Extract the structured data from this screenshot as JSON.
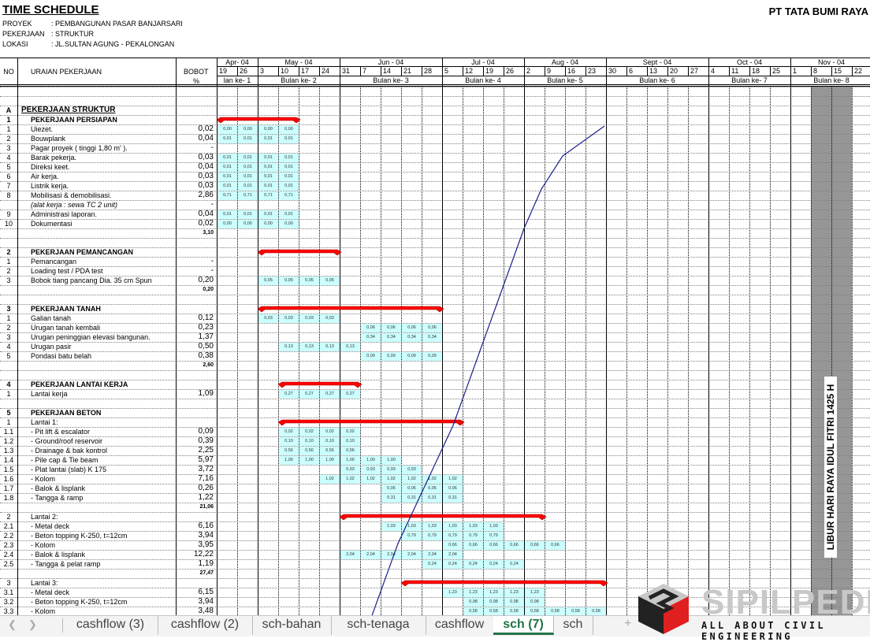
{
  "header": {
    "title": "TIME SCHEDULE",
    "company": "PT TATA BUMI RAYA",
    "meta": [
      {
        "key": "PROYEK",
        "value": ": PEMBANGUNAN PASAR BANJARSARI"
      },
      {
        "key": "PEKERJAAN",
        "value": ": STRUKTUR"
      },
      {
        "key": "LOKASI",
        "value": ": JL.SULTAN AGUNG - PEKALONGAN"
      }
    ]
  },
  "columns": {
    "no": "NO",
    "desc": "URAIAN PEKERJAAN",
    "bobot": "BOBOT",
    "pct": "%",
    "months": [
      {
        "label": "Apr- 04",
        "start": 0,
        "span": 2
      },
      {
        "label": "May - 04",
        "start": 2,
        "span": 4
      },
      {
        "label": "Jun - 04",
        "start": 6,
        "span": 5
      },
      {
        "label": "Jul - 04",
        "start": 11,
        "span": 4
      },
      {
        "label": "Aug - 04",
        "start": 15,
        "span": 4
      },
      {
        "label": "Sept - 04",
        "start": 19,
        "span": 5
      },
      {
        "label": "Oct - 04",
        "start": 24,
        "span": 4
      },
      {
        "label": "Nov - 04",
        "start": 28,
        "span": 4
      }
    ],
    "weeks": [
      "19",
      "26",
      "3",
      "10",
      "17",
      "24",
      "31",
      "7",
      "14",
      "21",
      "28",
      "5",
      "12",
      "19",
      "26",
      "2",
      "9",
      "16",
      "23",
      "30",
      "6",
      "13",
      "20",
      "27",
      "4",
      "11",
      "18",
      "25",
      "1",
      "8",
      "15",
      "22"
    ],
    "bulan": [
      {
        "label": "lan ke- 1",
        "start": 0,
        "span": 2
      },
      {
        "label": "Bulan ke- 2",
        "start": 2,
        "span": 4
      },
      {
        "label": "Bulan ke- 3",
        "start": 6,
        "span": 5
      },
      {
        "label": "Bulan ke- 4",
        "start": 11,
        "span": 4
      },
      {
        "label": "Bulan ke- 5",
        "start": 15,
        "span": 4
      },
      {
        "label": "Bulan ke- 6",
        "start": 19,
        "span": 5
      },
      {
        "label": "Bulan ke- 7",
        "start": 24,
        "span": 4
      },
      {
        "label": "Bulan ke- 8",
        "start": 28,
        "span": 4
      }
    ]
  },
  "rows": [
    {
      "type": "blank"
    },
    {
      "type": "blank"
    },
    {
      "type": "top",
      "no": "A",
      "desc": "PEKERJAAN STRUKTUR"
    },
    {
      "type": "section",
      "no": "1",
      "desc": "PEKERJAAN  PERSIAPAN",
      "bar": [
        0,
        4
      ]
    },
    {
      "no": "1",
      "desc": "Uiezet.",
      "bobot": "0,02",
      "start": 0,
      "cells": [
        "0,00",
        "0,00",
        "0,00",
        "0,00"
      ]
    },
    {
      "no": "2",
      "desc": "Bouwplank",
      "bobot": "0,04",
      "start": 0,
      "cells": [
        "0,01",
        "0,01",
        "0,01",
        "0,01"
      ]
    },
    {
      "no": "3",
      "desc": "Pagar proyek ( tinggi  1,80 m' ).",
      "bobot": "-"
    },
    {
      "no": "4",
      "desc": "Barak pekerja.",
      "bobot": "0,03",
      "start": 0,
      "cells": [
        "0,01",
        "0,01",
        "0,01",
        "0,01"
      ]
    },
    {
      "no": "5",
      "desc": "Direksi keet.",
      "bobot": "0,04",
      "start": 0,
      "cells": [
        "0,01",
        "0,01",
        "0,01",
        "0,01"
      ]
    },
    {
      "no": "6",
      "desc": "Air kerja.",
      "bobot": "0,03",
      "start": 0,
      "cells": [
        "0,01",
        "0,01",
        "0,01",
        "0,01"
      ]
    },
    {
      "no": "7",
      "desc": "Listrik kerja.",
      "bobot": "0,03",
      "start": 0,
      "cells": [
        "0,01",
        "0,01",
        "0,01",
        "0,01"
      ]
    },
    {
      "no": "8",
      "desc": "Mobilisasi & demobilisasi.",
      "bobot": "2,86",
      "start": 0,
      "cells": [
        "0,71",
        "0,71",
        "0,71",
        "0,71"
      ]
    },
    {
      "no": "",
      "desc": "(alat kerja : sewa TC 2 unit)",
      "bobot": "-",
      "italic": true
    },
    {
      "no": "9",
      "desc": "Administrasi laporan.",
      "bobot": "0,04",
      "start": 0,
      "cells": [
        "0,01",
        "0,01",
        "0,01",
        "0,01"
      ]
    },
    {
      "no": "10",
      "desc": "Dokumentasi",
      "bobot": "0,02",
      "start": 0,
      "cells": [
        "0,00",
        "0,00",
        "0,00",
        "0,00"
      ]
    },
    {
      "type": "subtotal",
      "bobot": "3,10"
    },
    {
      "type": "blank"
    },
    {
      "type": "section",
      "no": "2",
      "desc": "PEKERJAAN  PEMANCANGAN",
      "bar": [
        2,
        6
      ]
    },
    {
      "no": "1",
      "desc": "Pemancangan",
      "bobot": "-"
    },
    {
      "no": "2",
      "desc": "Loading test / PDA test",
      "bobot": "-"
    },
    {
      "no": "3",
      "desc": "Bobok  tiang pancang Dia. 35 cm Spun",
      "bobot": "0,20",
      "start": 2,
      "cells": [
        "0,05",
        "0,05",
        "0,05",
        "0,05"
      ]
    },
    {
      "type": "subtotal",
      "bobot": "0,20"
    },
    {
      "type": "blank"
    },
    {
      "type": "section",
      "no": "3",
      "desc": "PEKERJAAN  TANAH",
      "bar": [
        2,
        11
      ]
    },
    {
      "no": "1",
      "desc": "Galian tanah",
      "bobot": "0,12",
      "start": 2,
      "cells": [
        "0,03",
        "0,03",
        "0,03",
        "0,03"
      ]
    },
    {
      "no": "2",
      "desc": "Urugan tanah kembali",
      "bobot": "0,23",
      "start": 7,
      "cells": [
        "0,06",
        "0,06",
        "0,06",
        "0,06"
      ]
    },
    {
      "no": "3",
      "desc": "Urugan peninggian elevasi bangunan.",
      "bobot": "1,37",
      "start": 7,
      "cells": [
        "0,34",
        "0,34",
        "0,34",
        "0,34"
      ]
    },
    {
      "no": "4",
      "desc": "Urugan pasir",
      "bobot": "0,50",
      "start": 3,
      "cells": [
        "0,13",
        "0,13",
        "0,13",
        "0,13"
      ]
    },
    {
      "no": "5",
      "desc": "Pondasi batu belah",
      "bobot": "0,38",
      "start": 7,
      "cells": [
        "0,09",
        "0,09",
        "0,09",
        "0,09"
      ]
    },
    {
      "type": "subtotal",
      "bobot": "2,60"
    },
    {
      "type": "blank"
    },
    {
      "type": "section",
      "no": "4",
      "desc": "PEKERJAAN  LANTAI KERJA",
      "bar": [
        3,
        7
      ]
    },
    {
      "no": "1",
      "desc": "Lantai kerja",
      "bobot": "1,09",
      "start": 3,
      "cells": [
        "0,27",
        "0,27",
        "0,27",
        "0,27"
      ]
    },
    {
      "type": "blank"
    },
    {
      "type": "section",
      "no": "5",
      "desc": "PEKERJAAN  BETON"
    },
    {
      "no": "1",
      "desc": "Lantai 1:",
      "bar": [
        3,
        12
      ]
    },
    {
      "no": "1.1",
      "desc": "- Pit lift & escalator",
      "bobot": "0,09",
      "start": 3,
      "cells": [
        "0,02",
        "0,02",
        "0,02",
        "0,02"
      ]
    },
    {
      "no": "1.2",
      "desc": "- Ground/roof reservoir",
      "bobot": "0,39",
      "start": 3,
      "cells": [
        "0,10",
        "0,10",
        "0,10",
        "0,10"
      ]
    },
    {
      "no": "1.3",
      "desc": "- Drainage & bak kontrol",
      "bobot": "2,25",
      "start": 3,
      "cells": [
        "0,56",
        "0,56",
        "0,56",
        "0,56"
      ]
    },
    {
      "no": "1.4",
      "desc": "- Pile cap & Tie beam",
      "bobot": "5,97",
      "start": 3,
      "cells": [
        "1,00",
        "1,00",
        "1,00",
        "1,00",
        "1,00",
        "1,00"
      ]
    },
    {
      "no": "1.5",
      "desc": "- Plat lantai (slab) K 175",
      "bobot": "3,72",
      "start": 6,
      "cells": [
        "0,93",
        "0,93",
        "0,93",
        "0,93"
      ]
    },
    {
      "no": "1.6",
      "desc": "- Kolom",
      "bobot": "7,16",
      "start": 5,
      "cells": [
        "1,02",
        "1,02",
        "1,02",
        "1,02",
        "1,02",
        "1,02",
        "1,02"
      ]
    },
    {
      "no": "1.7",
      "desc": "- Balok & lisplank",
      "bobot": "0,26",
      "start": 8,
      "cells": [
        "0,06",
        "0,06",
        "0,06",
        "0,06"
      ]
    },
    {
      "no": "1.8",
      "desc": "- Tangga & ramp",
      "bobot": "1,22",
      "start": 8,
      "cells": [
        "0,31",
        "0,31",
        "0,31",
        "0,31"
      ]
    },
    {
      "type": "subtotal",
      "bobot": "21,06"
    },
    {
      "no": "2",
      "desc": "Lantai 2:",
      "bar": [
        6,
        16
      ]
    },
    {
      "no": "2.1",
      "desc": "- Metal deck",
      "bobot": "6,16",
      "start": 8,
      "cells": [
        "1,03",
        "1,03",
        "1,03",
        "1,03",
        "1,03",
        "1,03"
      ]
    },
    {
      "no": "2.2",
      "desc": "- Beton topping K-250, t=12cm",
      "bobot": "3,94",
      "start": 9,
      "cells": [
        "0,79",
        "0,79",
        "0,79",
        "0,79",
        "0,79"
      ]
    },
    {
      "no": "2.3",
      "desc": "- Kolom",
      "bobot": "3,95",
      "start": 11,
      "cells": [
        "0,66",
        "0,66",
        "0,66",
        "0,66",
        "0,66",
        "0,66"
      ]
    },
    {
      "no": "2.4",
      "desc": "- Balok & lisplank",
      "bobot": "12,22",
      "start": 6,
      "cells": [
        "2,04",
        "2,04",
        "2,04",
        "2,04",
        "2,04",
        "2,04"
      ]
    },
    {
      "no": "2.5",
      "desc": "- Tangga & pelat ramp",
      "bobot": "1,19",
      "start": 10,
      "cells": [
        "0,24",
        "0,24",
        "0,24",
        "0,24",
        "0,24"
      ]
    },
    {
      "type": "subtotal",
      "bobot": "27,47"
    },
    {
      "no": "3",
      "desc": "Lantai 3:",
      "bar": [
        9,
        19
      ]
    },
    {
      "no": "3.1",
      "desc": "- Metal deck",
      "bobot": "6,15",
      "start": 11,
      "cells": [
        "1,23",
        "1,23",
        "1,23",
        "1,23",
        "1,23"
      ]
    },
    {
      "no": "3.2",
      "desc": "- Beton topping K-250, t=12cm",
      "bobot": "3,94",
      "start": 12,
      "cells": [
        "0,98",
        "0,98",
        "0,98",
        "0,98"
      ]
    },
    {
      "no": "3.3",
      "desc": "- Kolom",
      "bobot": "3,48",
      "start": 12,
      "cells": [
        "0,58",
        "0,58",
        "0,58",
        "0,58",
        "0,58",
        "0,58",
        "0,58"
      ]
    }
  ],
  "holiday": {
    "label": "LIBUR HARI RAYA IDUL FITRI 1425 H",
    "weeks": [
      29,
      30
    ]
  },
  "s_curve": {
    "points": [
      [
        7.0,
        5.6
      ],
      [
        9.7,
        4.8
      ],
      [
        11.2,
        4.0
      ],
      [
        14.3,
        2.0
      ],
      [
        15.3,
        1.0
      ],
      [
        16.3,
        0.55
      ],
      [
        18.3,
        0.2
      ]
    ]
  },
  "colors": {
    "cell": "#ccffff",
    "bar": "#ff0000",
    "curve": "#1a1f8a",
    "holiday": "#969696",
    "tab_active": "#217346"
  },
  "tabs": {
    "items": [
      {
        "label": "cashflow (3)",
        "active": false
      },
      {
        "label": "cashflow (2)",
        "active": false
      },
      {
        "label": "sch-bahan",
        "active": false
      },
      {
        "label": "sch-tenaga",
        "active": false
      },
      {
        "label": "cashflow",
        "active": false
      },
      {
        "label": "sch (7)",
        "active": true
      },
      {
        "label": "sch",
        "active": false
      }
    ],
    "add_icon": "+"
  },
  "watermark": {
    "brand": "SIPILPEDIA",
    "tagline": "ALL ABOUT CIVIL ENGINEERING"
  }
}
